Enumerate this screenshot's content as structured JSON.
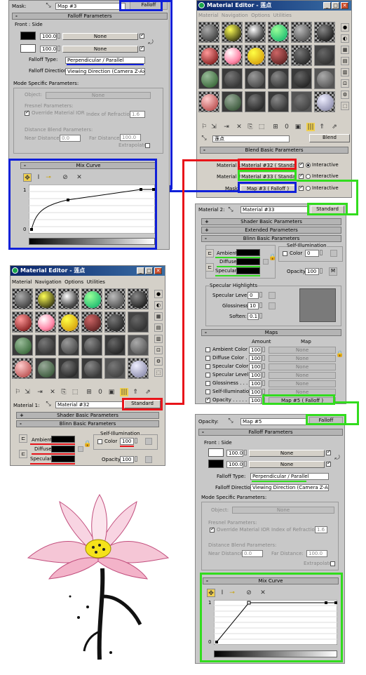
{
  "top_left": {
    "mask_label": "Mask:",
    "map_name": "Map #3",
    "type_button": "Falloff",
    "falloff_params": "Falloff Parameters",
    "front_side": "Front : Side",
    "front_value": "100.0",
    "front_map": "None",
    "side_value": "100.0",
    "side_map": "None",
    "falloff_type_label": "Falloff Type:",
    "falloff_type": "Perpendicular / Parallel",
    "falloff_direction_label": "Falloff Direction:",
    "falloff_direction": "Viewing Direction (Camera Z-Axis)",
    "mode_specific": "Mode Specific Parameters:",
    "object_label": "Object:",
    "object_value": "None",
    "fresnel": "Fresnel Parameters:",
    "override_ior": "Override Material IOR",
    "ior_label": "Index of Refraction",
    "ior_value": "1.6",
    "distance_blend": "Distance Blend Parameters:",
    "near_label": "Near Distance:",
    "near_value": "0.0",
    "far_label": "Far Distance:",
    "far_value": "100.0",
    "extrapolate": "Extrapolate",
    "mix_curve": "Mix Curve",
    "axis_top": "1",
    "axis_bottom": "0"
  },
  "top_right": {
    "title": "Material Editor - 莲点",
    "menus": [
      "Material",
      "Navigation",
      "Options",
      "Utilities"
    ],
    "mat_name": "莲点",
    "type_button": "Blend",
    "blend_params": "Blend Basic Parameters",
    "mat1_label": "Material 1:",
    "mat1_value": "Material #32  ( Standard )",
    "mat2_label": "Material 2:",
    "mat2_value": "Material #33  ( Standard )",
    "mask_label": "Mask:",
    "mask_value": "Map #3  ( Falloff )",
    "interactive": "Interactive"
  },
  "mid_right": {
    "material_label": "Material 2:",
    "material_value": "Material #33",
    "type_button": "Standard",
    "shader_basic": "Shader Basic Parameters",
    "extended": "Extended Parameters",
    "blinn_basic": "Blinn Basic Parameters",
    "self_illum": "Self-Illumination",
    "ambient": "Ambient:",
    "diffuse": "Diffuse:",
    "specular": "Specular:",
    "color_label": "Color",
    "color_value": "0",
    "opacity_label": "Opacity:",
    "opacity_value": "100",
    "opacity_btn": "M",
    "spec_highlights": "Specular Highlights",
    "spec_level": "Specular Level:",
    "spec_level_value": "0",
    "glossiness": "Glossiness:",
    "glossiness_value": "10",
    "soften": "Soften:",
    "soften_value": "0.1",
    "maps": "Maps",
    "amount_hdr": "Amount",
    "map_hdr": "Map",
    "map_rows": [
      {
        "name": "Ambient Color . .",
        "amount": "100",
        "map": "None"
      },
      {
        "name": "Diffuse Color . .",
        "amount": "100",
        "map": "None"
      },
      {
        "name": "Specular Color .",
        "amount": "100",
        "map": "None"
      },
      {
        "name": "Specular Level .",
        "amount": "100",
        "map": "None"
      },
      {
        "name": "Glossiness . . . .",
        "amount": "100",
        "map": "None"
      },
      {
        "name": "Self-Illumination .",
        "amount": "100",
        "map": "None"
      },
      {
        "name": "Opacity . . . . . .",
        "amount": "100",
        "map": "Map #5  ( Falloff )"
      }
    ]
  },
  "mid_left": {
    "title": "Material Editor - 莲点",
    "menus": [
      "Material",
      "Navigation",
      "Options",
      "Utilities"
    ],
    "material_label": "Material 1:",
    "material_value": "Material #32",
    "type_button": "Standard",
    "shader_basic": "Shader Basic Parameters",
    "blinn_basic": "Blinn Basic Parameters",
    "self_illum": "Self-Illumination",
    "ambient": "Ambient:",
    "diffuse": "Diffuse:",
    "specular": "Specular:",
    "color_label": "Color",
    "color_value": "100",
    "opacity_label": "Opacity:",
    "opacity_value": "100"
  },
  "bottom_right": {
    "opacity_label": "Opacity:",
    "map_name": "Map #5",
    "type_button": "Falloff",
    "falloff_params": "Falloff Parameters",
    "front_side": "Front : Side",
    "front_value": "100.0",
    "front_map": "None",
    "side_value": "100.0",
    "side_map": "None",
    "falloff_type_label": "Falloff Type:",
    "falloff_type": "Perpendicular / Parallel",
    "falloff_direction_label": "Falloff Direction:",
    "falloff_direction": "Viewing Direction (Camera Z-Axis)",
    "mode_specific": "Mode Specific Parameters:",
    "object_label": "Object:",
    "object_value": "None",
    "fresnel": "Fresnel Parameters:",
    "override_ior": "Override Material IOR",
    "ior_label": "Index of Refraction",
    "ior_value": "1.6",
    "distance_blend": "Distance Blend Parameters:",
    "near_label": "Near Distance:",
    "near_value": "0.0",
    "far_label": "Far Distance:",
    "far_value": "100.0",
    "extrapolate": "Extrapolate",
    "mix_curve": "Mix Curve",
    "axis_top": "1",
    "axis_bottom": "0"
  },
  "colors": {
    "highlight_blue": "#1020d8",
    "highlight_red": "#e8141a",
    "highlight_green": "#32dc1e",
    "panel_bg": "#c8c8c8",
    "lotus_pink": "#f5c6d6",
    "lotus_center": "#f5e21a"
  }
}
